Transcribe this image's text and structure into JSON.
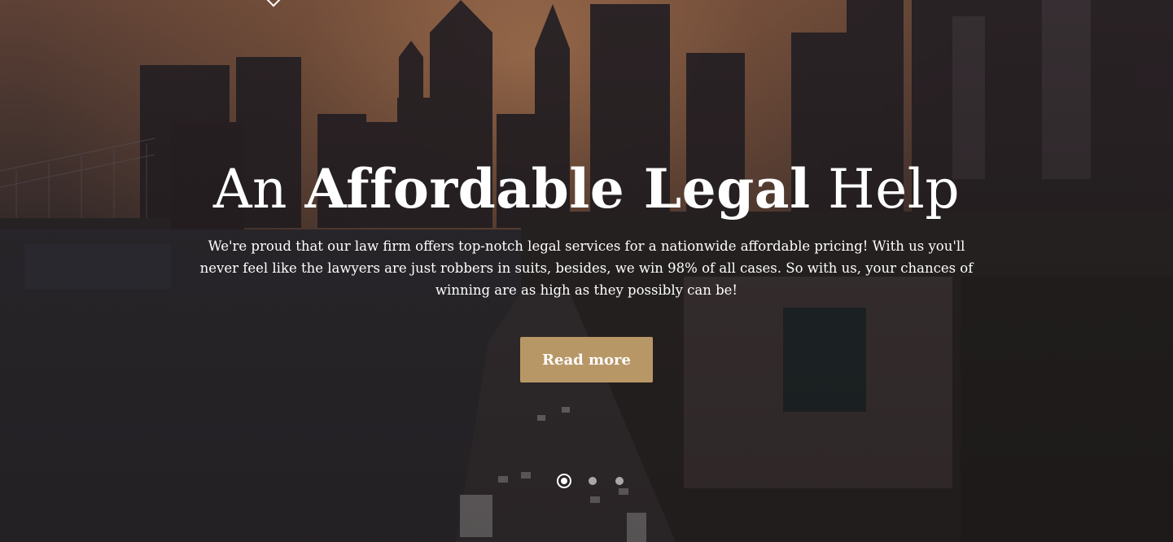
{
  "hero": {
    "headline_pre": "An ",
    "headline_bold": "Affordable Legal",
    "headline_post": " Help",
    "description": "We're proud that our law firm offers top-notch legal services for a nationwide affordable pricing! With us you'll never feel like the lawyers are just robbers in suits, besides, we win 98% of all cases. So with us, your chances of winning are as high as they possibly can be!",
    "cta_label": "Read more",
    "background_image_icon": "city-skyline-photo"
  },
  "slider": {
    "total_slides": 3,
    "active_index": 0
  },
  "colors": {
    "accent": "#b89766",
    "text": "#ffffff"
  }
}
